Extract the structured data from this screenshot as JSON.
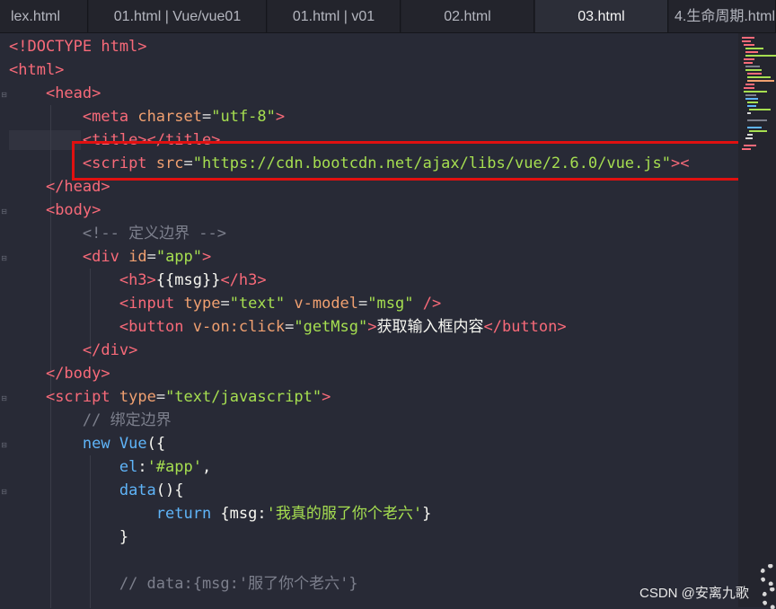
{
  "tabs": [
    {
      "label": "lex.html",
      "active": false
    },
    {
      "label": "01.html | Vue/vue01",
      "active": false
    },
    {
      "label": "01.html | v01",
      "active": false
    },
    {
      "label": "02.html",
      "active": false
    },
    {
      "label": "03.html",
      "active": true
    },
    {
      "label": "4.生命周期.html",
      "active": false
    }
  ],
  "code": {
    "l1": {
      "open": "<!DOCTYPE html>"
    },
    "l2": {
      "tag": "<html>"
    },
    "l3": {
      "tag": "<head>"
    },
    "l4": {
      "tag_open": "<meta",
      "attr": "charset",
      "eq": "=",
      "val": "\"utf-8\"",
      "close": ">"
    },
    "l5": {
      "text": "<title></title>"
    },
    "l6": {
      "tag_open": "<script",
      "attr": "src",
      "eq": "=",
      "val": "\"https://cdn.bootcdn.net/ajax/libs/vue/2.6.0/vue.js\"",
      "close": "><"
    },
    "l7": {
      "tag": "</head>"
    },
    "l8": {
      "tag": "<body>"
    },
    "l9": {
      "comment": "<!-- 定义边界 -->"
    },
    "l10": {
      "tag_open": "<div",
      "attr": "id",
      "eq": "=",
      "val": "\"app\"",
      "close": ">"
    },
    "l11": {
      "open": "<h3>",
      "text": "{{msg}}",
      "close": "</h3>"
    },
    "l12": {
      "tag_open": "<input",
      "attr1": "type",
      "eq1": "=",
      "val1": "\"text\"",
      "attr2": "v-model",
      "eq2": "=",
      "val2": "\"msg\"",
      "close": " />"
    },
    "l13": {
      "tag_open": "<button",
      "attr": "v-on:click",
      "eq": "=",
      "val": "\"getMsg\"",
      "gt": ">",
      "text": "获取输入框内容",
      "close": "</button>"
    },
    "l14": {
      "tag": "</div>"
    },
    "l15": {
      "tag": "</body>"
    },
    "l16": {
      "tag_open": "<script",
      "attr": "type",
      "eq": "=",
      "val": "\"text/javascript\"",
      "close": ">"
    },
    "l17": {
      "comment": "// 绑定边界"
    },
    "l18": {
      "kw": "new",
      "cls": "Vue",
      "rest": "({"
    },
    "l19": {
      "prop": "el",
      "colon": ":",
      "val": "'#app'",
      "comma": ","
    },
    "l20": {
      "prop": "data",
      "rest": "(){"
    },
    "l21": {
      "kw": "return",
      "open": " {msg:",
      "val": "'我真的服了你个老六'",
      "close": "}"
    },
    "l22": {
      "text": "}"
    },
    "l23": {
      "text": ""
    },
    "l24": {
      "comment": "// data:{msg:'服了你个老六'}"
    }
  },
  "watermark": "CSDN @安离九歌",
  "colors": {
    "highlight_box": "#e01010",
    "background": "#282a36"
  }
}
